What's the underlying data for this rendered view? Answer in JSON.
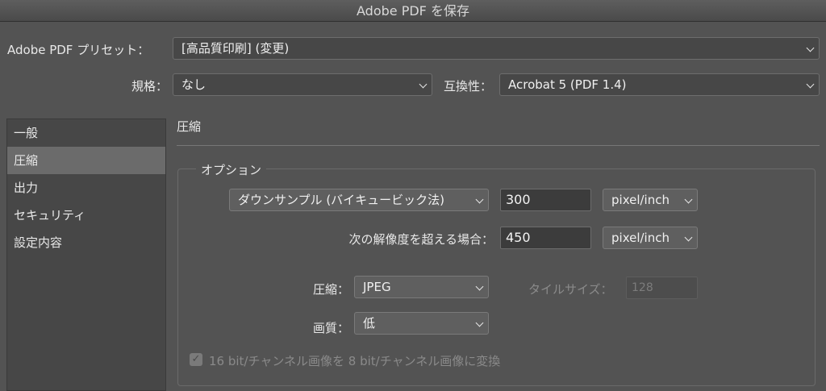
{
  "window": {
    "title": "Adobe PDF を保存"
  },
  "preset": {
    "label": "Adobe PDF プリセット：",
    "value": "[高品質印刷] (変更)"
  },
  "standard": {
    "label": "規格：",
    "value": "なし"
  },
  "compat": {
    "label": "互換性：",
    "value": "Acrobat 5 (PDF 1.4)"
  },
  "sidebar": {
    "items": [
      {
        "label": "一般"
      },
      {
        "label": "圧縮"
      },
      {
        "label": "出力"
      },
      {
        "label": "セキュリティ"
      },
      {
        "label": "設定内容"
      }
    ],
    "selected": "圧縮"
  },
  "main": {
    "heading": "圧縮",
    "group_title": "オプション",
    "downsample": {
      "method": "ダウンサンプル (バイキュービック法)",
      "ppi": "300",
      "unit": "pixel/inch"
    },
    "threshold": {
      "label": "次の解像度を超える場合：",
      "ppi": "450",
      "unit": "pixel/inch"
    },
    "compression": {
      "label": "圧縮：",
      "value": "JPEG"
    },
    "tile": {
      "label": "タイルサイズ：",
      "value": "128"
    },
    "quality": {
      "label": "画質：",
      "value": "低"
    },
    "convert16": {
      "label": "16 bit/チャンネル画像を 8 bit/チャンネル画像に変換",
      "checked": true
    }
  },
  "colors": {
    "background": "#535353",
    "panel": "#474747",
    "selected": "#6b6b6b"
  }
}
